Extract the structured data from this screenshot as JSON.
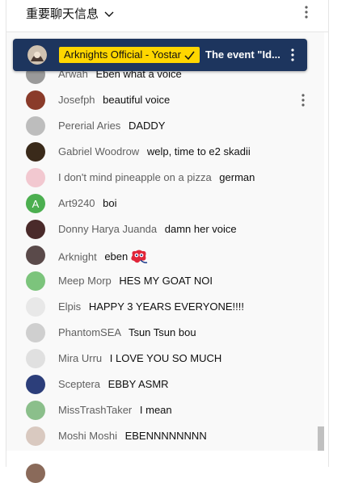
{
  "header": {
    "title": "重要聊天信息"
  },
  "pinned": {
    "author": "Arknights Official - Yostar",
    "text": "The event \"Id...",
    "avatar_color": "#6b5a4e"
  },
  "messages": [
    {
      "author": "Arwah",
      "text": "Eben what a voice",
      "avatar": "#9a9a9a"
    },
    {
      "author": "Josefph",
      "text": "beautiful voice",
      "avatar": "#8a3b2a"
    },
    {
      "author": "Pererial Aries",
      "text": "DADDY",
      "avatar": "#bdbdbd"
    },
    {
      "author": "Gabriel Woodrow",
      "text": "welp, time to e2 skadii",
      "avatar": "#3a2a1a"
    },
    {
      "author": "I don't mind pineapple on a pizza",
      "text": "german",
      "avatar": "#f2c8d0"
    },
    {
      "author": "Art9240",
      "text": "boi",
      "avatar": "#4caf50",
      "initial": "A"
    },
    {
      "author": "Donny Harya Juanda",
      "text": "damn her voice",
      "avatar": "#4a2a2a"
    },
    {
      "author": "Arknight",
      "text": "eben",
      "avatar": "#5a4a4a",
      "emoji": true
    },
    {
      "author": "Meep Morp",
      "text": "HES MY GOAT NOI",
      "avatar": "#7cc47c"
    },
    {
      "author": "Elpis",
      "text": "HAPPY 3 YEARS EVERYONE!!!!",
      "avatar": "#e8e8e8"
    },
    {
      "author": "PhantomSEA",
      "text": "Tsun Tsun bou",
      "avatar": "#cfcfcf"
    },
    {
      "author": "Mira Urru",
      "text": "I LOVE YOU SO MUCH",
      "avatar": "#e0e0e0"
    },
    {
      "author": "Sceptera",
      "text": "EBBY ASMR",
      "avatar": "#2c3e7a"
    },
    {
      "author": "MissTrashTaker",
      "text": "I mean",
      "avatar": "#8bbf8b"
    },
    {
      "author": "Moshi Moshi",
      "text": "EBENNNNNNNN",
      "avatar": "#d9c9c0"
    }
  ],
  "colors": {
    "pinned_bg": "#1d355e",
    "badge_bg": "#ffd600",
    "author": "#606060",
    "chat_bg": "#f9f9f9"
  },
  "icons": [
    "chevron-down-icon",
    "more-vert-icon",
    "checkmark-icon",
    "kebab-icon"
  ]
}
